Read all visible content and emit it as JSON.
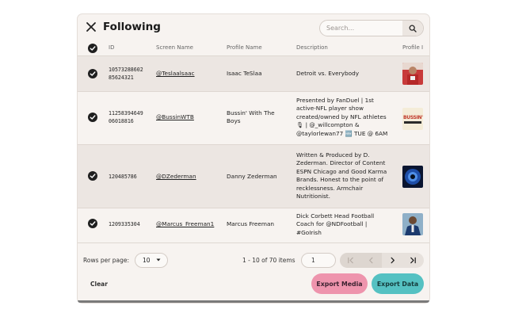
{
  "header": {
    "title": "Following",
    "search_placeholder": "Search..."
  },
  "table": {
    "columns": [
      "ID",
      "Screen Name",
      "Profile Name",
      "Description",
      "Profile I"
    ],
    "rows": [
      {
        "id_line1": "10573288602",
        "id_line2": "85624321",
        "screen_name": "@Teslaalsaac",
        "profile_name_line1": "Isaac TeSlaa",
        "profile_name_line2": "",
        "desc": [
          "Detroit vs. Everybody"
        ],
        "thumb_icon": "profile-photo-red-jersey"
      },
      {
        "id_line1": "11258394649",
        "id_line2": "06018816",
        "screen_name": "@BussinWTB",
        "profile_name_line1": "Bussin' With The",
        "profile_name_line2": "Boys",
        "desc": [
          "Presented by FanDuel | 1st",
          "active-NFL player show",
          "created/owned by NFL athletes",
          "🎙 | @_willcompton &",
          "@taylorlewan77 🆕 TUE @ 6AM"
        ],
        "thumb_icon": "bussin-logo",
        "thumb_text": "BUSSIN'"
      },
      {
        "id_line1": "120485786",
        "id_line2": "",
        "screen_name": "@DZederman",
        "profile_name_line1": "Danny Zederman",
        "profile_name_line2": "",
        "desc": [
          "Written & Produced by D.",
          "Zederman. Director of Content",
          "ESPN Chicago and Good Karma",
          "Brands. Honest to the point of",
          "recklessness. Armchair",
          "Nutritionist."
        ],
        "thumb_icon": "profile-photo-blue-eye"
      },
      {
        "id_line1": "1209335304",
        "id_line2": "",
        "screen_name": "@Marcus_Freeman1",
        "profile_name_line1": "Marcus Freeman",
        "profile_name_line2": "",
        "desc": [
          "Dick Corbett Head Football",
          "Coach for @NDFootball |",
          "#GoIrish"
        ],
        "thumb_icon": "profile-photo-man-suit"
      }
    ]
  },
  "pagination": {
    "rows_per_page_label": "Rows per page:",
    "rows_per_page_value": "10",
    "range_text": "1 - 10 of 70 items",
    "page_value": "1"
  },
  "footer": {
    "clear_label": "Clear",
    "export_media_label": "Export Media",
    "export_data_label": "Export Data"
  },
  "colors": {
    "panel_bg": "#f7f3f0",
    "export_media": "#ee94ad",
    "export_data": "#55c1c2"
  }
}
